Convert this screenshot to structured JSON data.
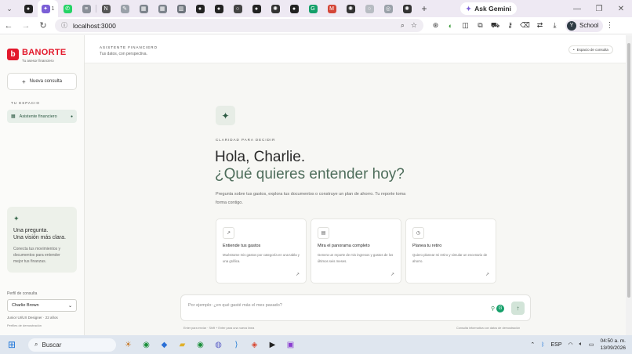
{
  "browser": {
    "tabs": [
      {
        "icon": "gemini-icon",
        "glyph": "✦",
        "color": "#7b5fd6",
        "label": "1"
      },
      {
        "icon": "whatsapp-icon",
        "glyph": "✆",
        "color": "#25d366"
      },
      {
        "icon": "gmail-icon",
        "glyph": "M",
        "color": "#d44638"
      },
      {
        "icon": "github-icon",
        "glyph": "●",
        "color": "#222222"
      },
      {
        "icon": "chatgpt-icon",
        "glyph": "✺",
        "color": "#10a37f"
      }
    ],
    "ask_gemini": "Ask Gemini",
    "url": "localhost:3000",
    "profile_initial": "Y",
    "profile_name": "School",
    "window_controls": [
      "—",
      "❐",
      "✕"
    ]
  },
  "sidebar": {
    "brand_name": "BANORTE",
    "brand_mark": "b",
    "brand_tagline": "Tu asesor financiero",
    "new_chat_label": "Nueva consulta",
    "section_label": "TU ESPACIO",
    "nav_item_label": "Asistente financiero",
    "promo_title_1": "Una pregunta.",
    "promo_title_2": "Una visión más clara.",
    "promo_body": "Conecta tus movimientos y documentos para entender mejor tus finanzas.",
    "profile_label": "Perfil de consulta",
    "profile_value": "Charlie Brown",
    "profile_role": "Junior UI/UX Designer · 22 años",
    "profile_note": "Perfiles de demostración"
  },
  "topbar": {
    "eyebrow": "ASISTENTE FINANCIERO",
    "subtitle": "Tus datos, con perspectiva.",
    "chip_label": "Espacio de consulta"
  },
  "hero": {
    "eyebrow": "CLARIDAD PARA DECIDIR",
    "greeting": "Hola, Charlie.",
    "question": "¿Qué quieres entender hoy?",
    "body": "Pregunta sobre tus gastos, explora tus documentos o construye un plan de ahorro. Tu reporte toma forma contigo."
  },
  "cards": [
    {
      "icon": "trend-icon",
      "glyph": "↗",
      "title": "Entiende tus gastos",
      "body": "Muéstrame mis gastos por categoría en una tabla y una gráfica."
    },
    {
      "icon": "table-icon",
      "glyph": "▤",
      "title": "Mira el panorama completo",
      "body": "Genera un reporte de mis ingresos y gastos de los últimos seis meses."
    },
    {
      "icon": "clock-icon",
      "glyph": "◷",
      "title": "Planea tu retiro",
      "body": "Quiero planear mi retiro y simular un escenario de ahorro."
    }
  ],
  "composer": {
    "placeholder": "Por ejemplo: ¿en qué gasté más el mes pasado?",
    "hint_left": "Enter para enviar · Shift + Enter para una nueva línea",
    "hint_right": "Consulta informativa con datos de demostración"
  },
  "taskbar": {
    "search_label": "Buscar",
    "language": "ESP",
    "time": "04:50 a. m.",
    "date": "13/09/2026"
  }
}
